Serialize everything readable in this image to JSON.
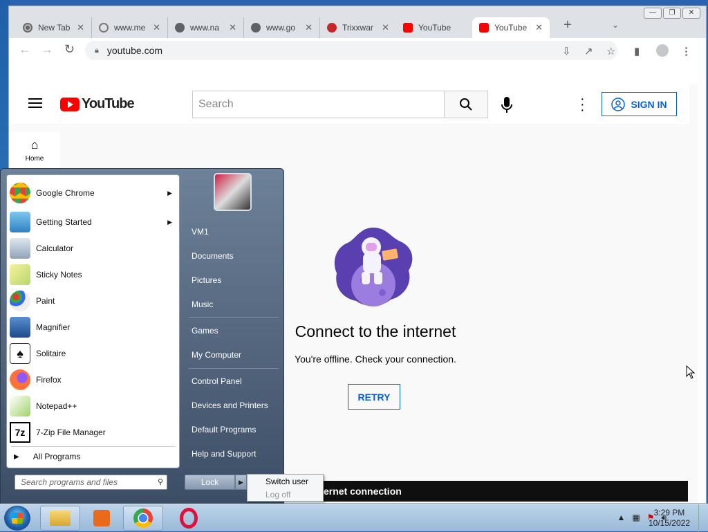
{
  "browser": {
    "tabs": [
      {
        "title": "New Tab",
        "favicon": "chrome-icon",
        "active": false
      },
      {
        "title": "www.me",
        "favicon": "loading-icon",
        "active": false
      },
      {
        "title": "www.na",
        "favicon": "globe-icon",
        "active": false
      },
      {
        "title": "www.go",
        "favicon": "globe-icon",
        "active": false
      },
      {
        "title": "Trixxwar",
        "favicon": "trixx-icon",
        "active": false
      },
      {
        "title": "YouTube",
        "favicon": "youtube-icon",
        "active": false
      },
      {
        "title": "YouTube",
        "favicon": "youtube-icon",
        "active": true
      }
    ],
    "tab_close": "✕",
    "new_tab": "+",
    "url": "youtube.com",
    "colors": {
      "tabstrip": "#dee1e6",
      "accent": "#065fd4",
      "youtube_red": "#ff0000"
    }
  },
  "youtube": {
    "logo_text": "YouTube",
    "search_placeholder": "Search",
    "sign_in": "SIGN IN",
    "home_label": "Home",
    "offline_title": "Connect to the internet",
    "offline_message": "You're offline. Check your connection.",
    "retry": "RETRY",
    "banner": "ernet connection"
  },
  "start_menu": {
    "programs": [
      {
        "label": "Google Chrome",
        "icon": "chrome-icon",
        "submenu": true
      },
      {
        "label": "Getting Started",
        "icon": "getting-started-icon",
        "submenu": true
      },
      {
        "label": "Calculator",
        "icon": "calculator-icon",
        "submenu": false
      },
      {
        "label": "Sticky Notes",
        "icon": "sticky-notes-icon",
        "submenu": false
      },
      {
        "label": "Paint",
        "icon": "paint-icon",
        "submenu": false
      },
      {
        "label": "Magnifier",
        "icon": "magnifier-icon",
        "submenu": false
      },
      {
        "label": "Solitaire",
        "icon": "solitaire-icon",
        "submenu": false
      },
      {
        "label": "Firefox",
        "icon": "firefox-icon",
        "submenu": false
      },
      {
        "label": "Notepad++",
        "icon": "notepadpp-icon",
        "submenu": false
      },
      {
        "label": "7-Zip File Manager",
        "icon": "7zip-icon",
        "submenu": false
      }
    ],
    "all_programs": "All Programs",
    "search_placeholder": "Search programs and files",
    "right_items": [
      "VM1",
      "Documents",
      "Pictures",
      "Music",
      "Games",
      "My Computer",
      "Control Panel",
      "Devices and Printers",
      "Default Programs",
      "Help and Support"
    ],
    "lock": "Lock",
    "power_menu": [
      "Switch user",
      "Log off"
    ]
  },
  "taskbar": {
    "time": "3:29 PM",
    "date": "10/15/2022"
  }
}
